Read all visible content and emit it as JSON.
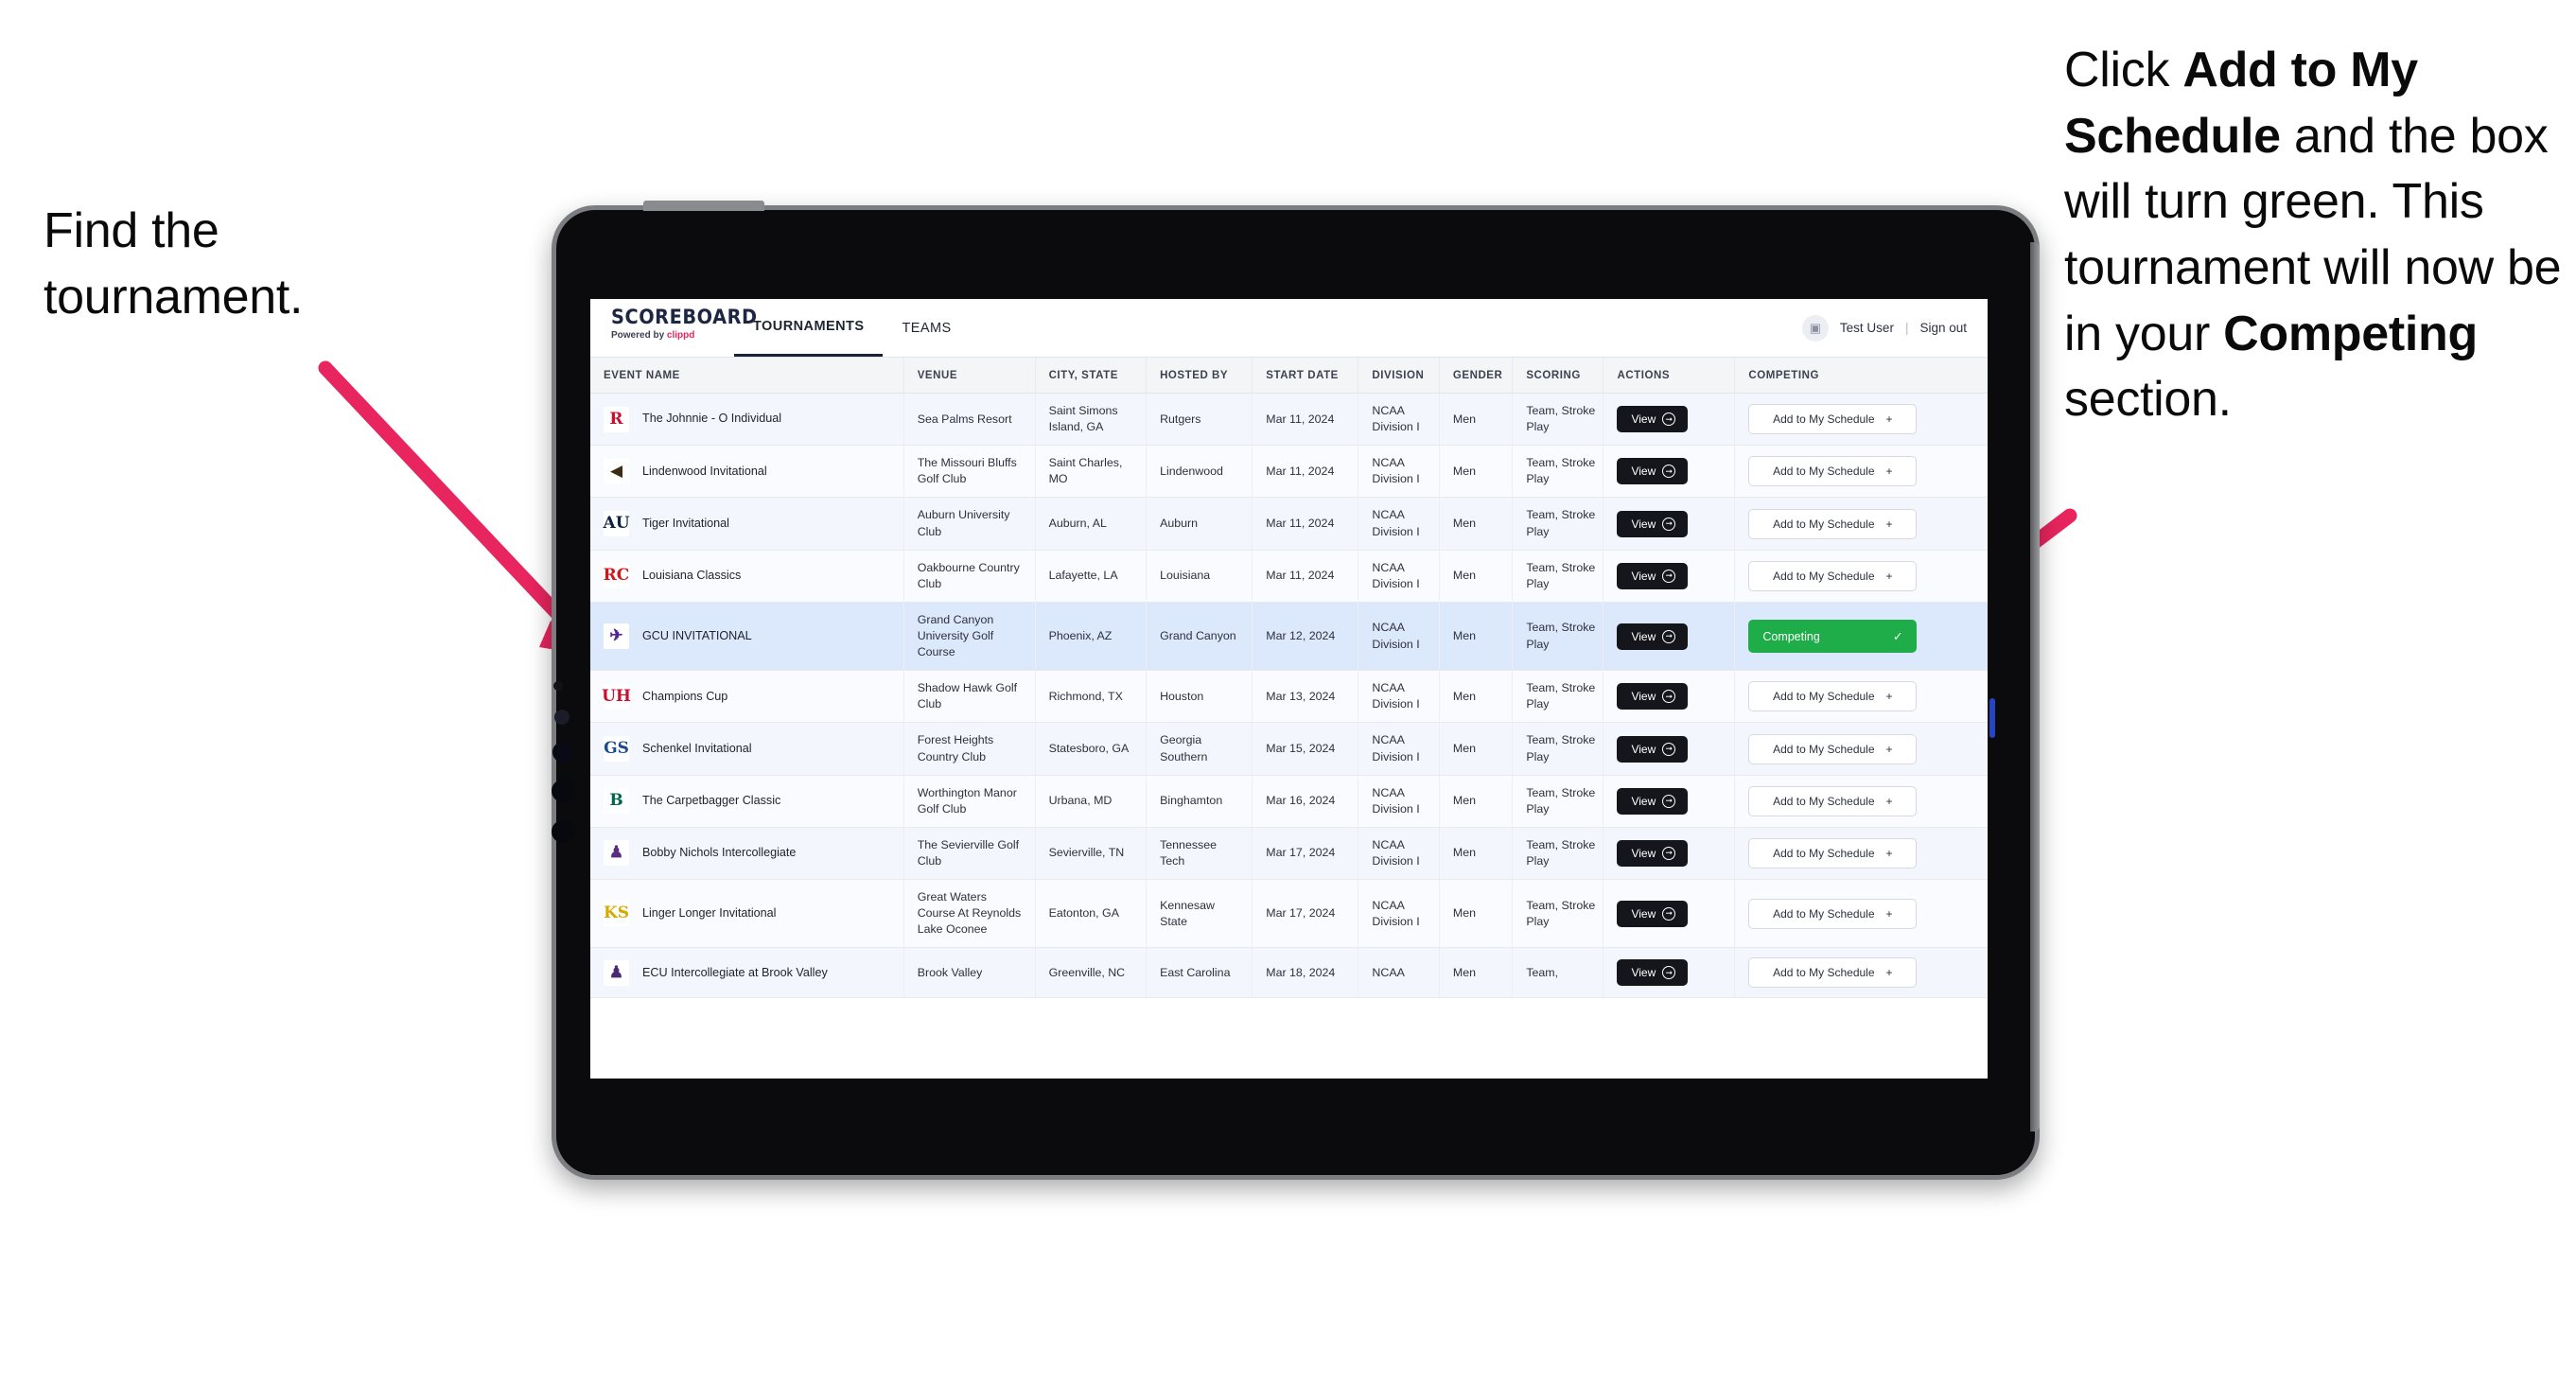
{
  "annotations": {
    "left": {
      "line1": "Find the",
      "line2": "tournament."
    },
    "right": {
      "p1a": "Click ",
      "p1b": "Add to My Schedule",
      "p1c": " and the box will turn green. This tournament will now be in your ",
      "p1d": "Competing",
      "p1e": " section."
    },
    "arrow_color": "#e8255f"
  },
  "app": {
    "brand": {
      "title": "SCOREBOARD",
      "powered_prefix": "Powered by ",
      "powered_name": "clippd"
    },
    "nav": {
      "tabs": [
        {
          "label": "TOURNAMENTS",
          "active": true
        },
        {
          "label": "TEAMS",
          "active": false
        }
      ]
    },
    "account": {
      "avatar_icon": "user-tile-icon",
      "user": "Test User",
      "separator": "|",
      "signout": "Sign out"
    },
    "table": {
      "columns": [
        "EVENT NAME",
        "VENUE",
        "CITY, STATE",
        "HOSTED BY",
        "START DATE",
        "DIVISION",
        "GENDER",
        "SCORING",
        "ACTIONS",
        "COMPETING"
      ],
      "view_label": "View",
      "add_label": "Add to My Schedule",
      "add_icon": "plus-icon",
      "competing_label": "Competing",
      "competing_icon": "check-icon",
      "competing_color": "#1ead48",
      "rows": [
        {
          "logo": "R",
          "logo_color": "#c8102e",
          "logo_bg": "#ffffff",
          "event": "The Johnnie - O Individual",
          "venue": "Sea Palms Resort",
          "city": "Saint Simons Island, GA",
          "host": "Rutgers",
          "date": "Mar 11, 2024",
          "division": "NCAA Division I",
          "gender": "Men",
          "scoring": "Team, Stroke Play",
          "competing": false,
          "selected": false
        },
        {
          "logo": "◀",
          "logo_color": "#3a2d12",
          "logo_bg": "#ffffff",
          "event": "Lindenwood Invitational",
          "venue": "The Missouri Bluffs Golf Club",
          "city": "Saint Charles, MO",
          "host": "Lindenwood",
          "date": "Mar 11, 2024",
          "division": "NCAA Division I",
          "gender": "Men",
          "scoring": "Team, Stroke Play",
          "competing": false,
          "selected": false
        },
        {
          "logo": "AU",
          "logo_color": "#0c2340",
          "logo_bg": "#ffffff",
          "event": "Tiger Invitational",
          "venue": "Auburn University Club",
          "city": "Auburn, AL",
          "host": "Auburn",
          "date": "Mar 11, 2024",
          "division": "NCAA Division I",
          "gender": "Men",
          "scoring": "Team, Stroke Play",
          "competing": false,
          "selected": false
        },
        {
          "logo": "RC",
          "logo_color": "#ce181e",
          "logo_bg": "#ffffff",
          "event": "Louisiana Classics",
          "venue": "Oakbourne Country Club",
          "city": "Lafayette, LA",
          "host": "Louisiana",
          "date": "Mar 11, 2024",
          "division": "NCAA Division I",
          "gender": "Men",
          "scoring": "Team, Stroke Play",
          "competing": false,
          "selected": false
        },
        {
          "logo": "✈",
          "logo_color": "#522398",
          "logo_bg": "#ffffff",
          "event": "GCU INVITATIONAL",
          "venue": "Grand Canyon University Golf Course",
          "city": "Phoenix, AZ",
          "host": "Grand Canyon",
          "date": "Mar 12, 2024",
          "division": "NCAA Division I",
          "gender": "Men",
          "scoring": "Team, Stroke Play",
          "competing": true,
          "selected": true
        },
        {
          "logo": "UH",
          "logo_color": "#c8102e",
          "logo_bg": "#ffffff",
          "event": "Champions Cup",
          "venue": "Shadow Hawk Golf Club",
          "city": "Richmond, TX",
          "host": "Houston",
          "date": "Mar 13, 2024",
          "division": "NCAA Division I",
          "gender": "Men",
          "scoring": "Team, Stroke Play",
          "competing": false,
          "selected": false
        },
        {
          "logo": "GS",
          "logo_color": "#1b4b8f",
          "logo_bg": "#ffffff",
          "event": "Schenkel Invitational",
          "venue": "Forest Heights Country Club",
          "city": "Statesboro, GA",
          "host": "Georgia Southern",
          "date": "Mar 15, 2024",
          "division": "NCAA Division I",
          "gender": "Men",
          "scoring": "Team, Stroke Play",
          "competing": false,
          "selected": false
        },
        {
          "logo": "B",
          "logo_color": "#00664f",
          "logo_bg": "#ffffff",
          "event": "The Carpetbagger Classic",
          "venue": "Worthington Manor Golf Club",
          "city": "Urbana, MD",
          "host": "Binghamton",
          "date": "Mar 16, 2024",
          "division": "NCAA Division I",
          "gender": "Men",
          "scoring": "Team, Stroke Play",
          "competing": false,
          "selected": false
        },
        {
          "logo": "♟",
          "logo_color": "#5b2c83",
          "logo_bg": "#ffffff",
          "event": "Bobby Nichols Intercollegiate",
          "venue": "The Sevierville Golf Club",
          "city": "Sevierville, TN",
          "host": "Tennessee Tech",
          "date": "Mar 17, 2024",
          "division": "NCAA Division I",
          "gender": "Men",
          "scoring": "Team, Stroke Play",
          "competing": false,
          "selected": false
        },
        {
          "logo": "KS",
          "logo_color": "#d6a800",
          "logo_bg": "#ffffff",
          "event": "Linger Longer Invitational",
          "venue": "Great Waters Course At Reynolds Lake Oconee",
          "city": "Eatonton, GA",
          "host": "Kennesaw State",
          "date": "Mar 17, 2024",
          "division": "NCAA Division I",
          "gender": "Men",
          "scoring": "Team, Stroke Play",
          "competing": false,
          "selected": false
        },
        {
          "logo": "♟",
          "logo_color": "#4b2a72",
          "logo_bg": "#ffffff",
          "event": "ECU Intercollegiate at Brook Valley",
          "venue": "Brook Valley",
          "city": "Greenville, NC",
          "host": "East Carolina",
          "date": "Mar 18, 2024",
          "division": "NCAA",
          "gender": "Men",
          "scoring": "Team,",
          "competing": false,
          "selected": false,
          "cut": true
        }
      ]
    }
  }
}
